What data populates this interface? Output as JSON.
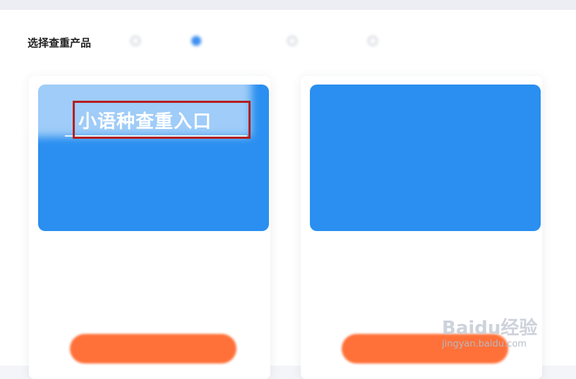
{
  "section": {
    "label": "选择查重产品"
  },
  "radio_options": [
    "",
    "",
    "",
    ""
  ],
  "cards": [
    {
      "banner_title": "",
      "banner_lines": [
        "",
        "",
        ""
      ],
      "name": "",
      "price": "",
      "button_label": ""
    },
    {
      "banner_title": "",
      "banner_lines": [
        "",
        "",
        ""
      ],
      "name": "",
      "price": "",
      "button_label": ""
    }
  ],
  "highlight": {
    "title": "小语种查重入口",
    "box_color": "#b41e1e"
  },
  "colors": {
    "banner_blue": "#2a8ff0",
    "button_orange": "#ff7139",
    "price_red": "#ff6b3d"
  },
  "watermark": {
    "logo": "Baidu经验",
    "url": "jingyan.baidu.com"
  }
}
